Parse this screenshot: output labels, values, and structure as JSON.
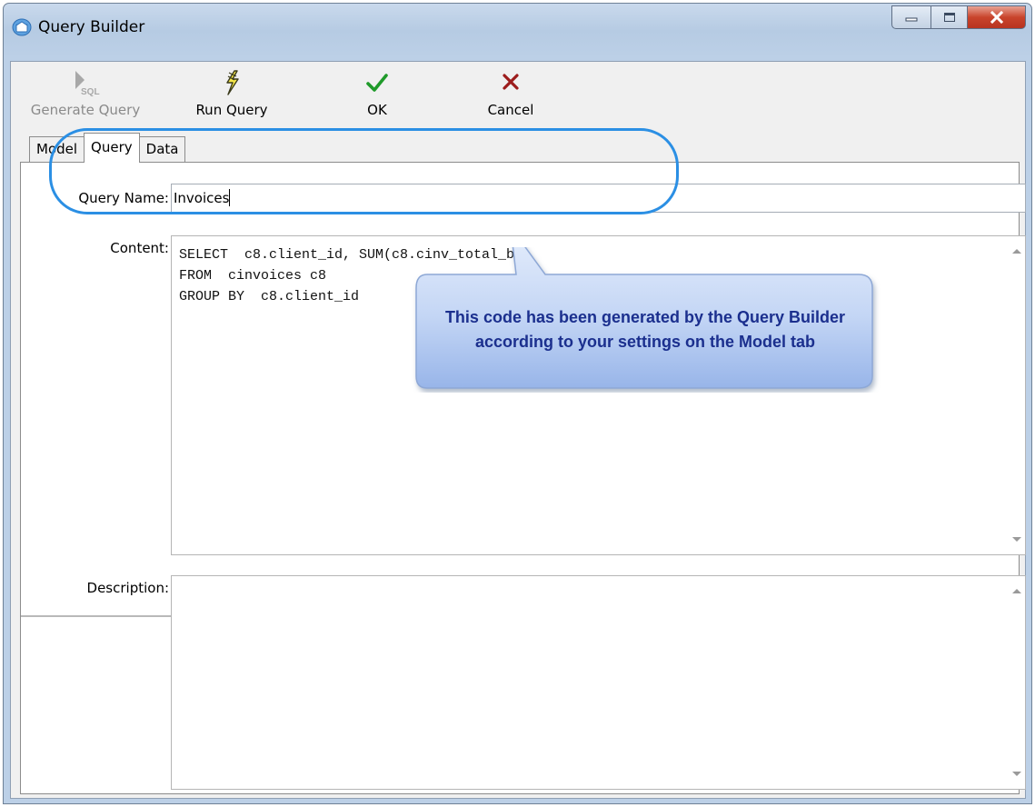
{
  "window": {
    "title": "Query Builder",
    "icons": {
      "app": "database-icon",
      "minimize": "minimize-icon",
      "maximize": "maximize-icon",
      "close": "close-icon"
    }
  },
  "toolbar": {
    "buttons": [
      {
        "label": "Generate Query",
        "icon": "generate-sql-icon",
        "enabled": false
      },
      {
        "label": "Run Query",
        "icon": "lightning-icon",
        "enabled": true
      },
      {
        "label": "OK",
        "icon": "checkmark-icon",
        "enabled": true
      },
      {
        "label": "Cancel",
        "icon": "x-icon",
        "enabled": true
      }
    ]
  },
  "tabs": [
    {
      "label": "Model",
      "active": false
    },
    {
      "label": "Query",
      "active": true
    },
    {
      "label": "Data",
      "active": false
    }
  ],
  "form": {
    "query_name_label": "Query Name:",
    "query_name_value": "Invoices",
    "content_label": "Content:",
    "content_value": "SELECT  c8.client_id, SUM(c8.cinv_total_b)\nFROM  cinvoices c8\nGROUP BY  c8.client_id",
    "description_label": "Description:",
    "description_value": ""
  },
  "callout": {
    "text": "This code has been generated by the Query Builder according to your settings on the Model tab"
  },
  "colors": {
    "callout_text": "#1b2f8e",
    "callout_fill_top": "#dfe9fb",
    "callout_fill_bottom": "#9ab7ea",
    "highlight_border": "#2b8fe4",
    "ok_check": "#1f9a2a",
    "cancel_x": "#9c1c1c"
  }
}
